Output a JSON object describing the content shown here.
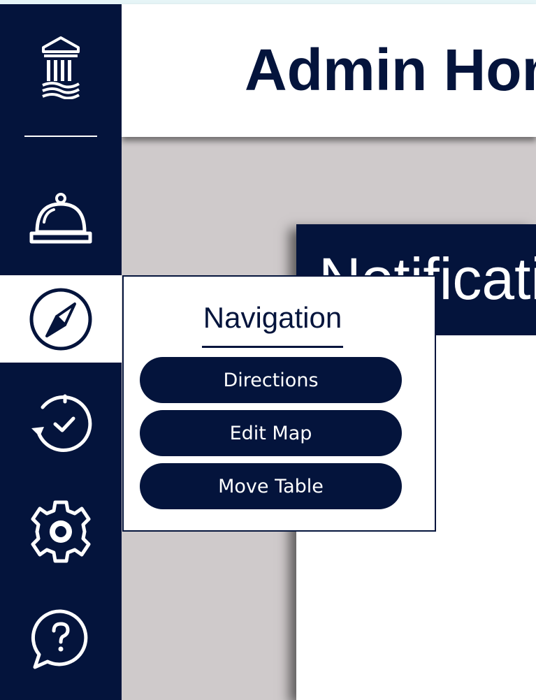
{
  "header": {
    "title": "Admin Home"
  },
  "notifications": {
    "title": "Notifications"
  },
  "sidebar": {
    "items": [
      {
        "icon": "building-logo-icon"
      },
      {
        "icon": "service-bell-icon"
      },
      {
        "icon": "compass-icon",
        "active": true
      },
      {
        "icon": "history-clock-check-icon"
      },
      {
        "icon": "gear-icon"
      },
      {
        "icon": "help-chat-icon"
      }
    ]
  },
  "navigation_menu": {
    "title": "Navigation",
    "buttons": [
      "Directions",
      "Edit Map",
      "Move Table"
    ]
  },
  "colors": {
    "navy": "#04143c",
    "background": "#cfcacb",
    "white": "#ffffff"
  }
}
